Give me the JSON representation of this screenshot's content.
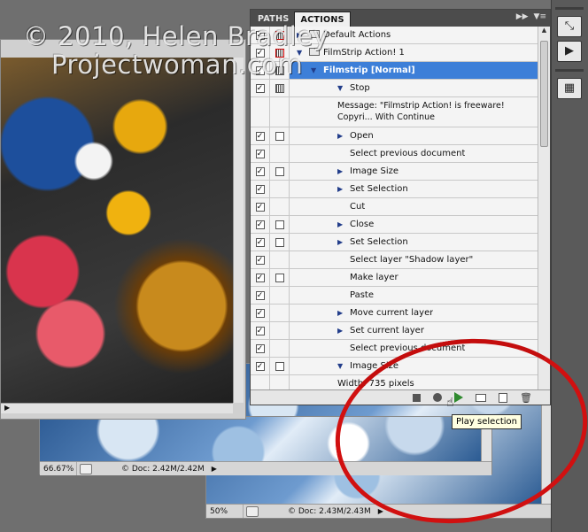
{
  "watermark": {
    "line1": "© 2010, Helen Bradley",
    "line2": "Projectwoman.com"
  },
  "docs": {
    "back": {
      "zoom": "50%",
      "size": "© Doc: 2.43M/2.43M"
    },
    "middle": {
      "zoom": "66.67%",
      "size": "© Doc: 2.42M/2.42M"
    }
  },
  "panel": {
    "tabs": [
      {
        "label": "PATHS",
        "active": false
      },
      {
        "label": "ACTIONS",
        "active": true
      }
    ],
    "menu_icons": [
      "collapse-icon",
      "panel-menu-icon"
    ],
    "rows": [
      {
        "label": "Default Actions",
        "checked": true,
        "dialog": "red",
        "level": 0,
        "expander": "right",
        "folder": true
      },
      {
        "label": "FilmStrip Action! 1",
        "checked": true,
        "dialog": "red",
        "level": 0,
        "expander": "down",
        "folder": true
      },
      {
        "label": "Filmstrip [Normal]",
        "checked": true,
        "dialog": "dotted",
        "level": 1,
        "expander": "down",
        "selected": true
      },
      {
        "label": "Stop",
        "checked": true,
        "dialog": "dotted",
        "level": 2,
        "expander": "down"
      },
      {
        "label": "Message: \"Filmstrip Action! is freeware! Copyri... With Continue",
        "checked": false,
        "dialog": "none",
        "level": 3,
        "expander": "none",
        "tall": true
      },
      {
        "label": "Open",
        "checked": true,
        "dialog": "empty",
        "level": 2,
        "expander": "right"
      },
      {
        "label": "Select previous document",
        "checked": true,
        "dialog": "none",
        "level": 2,
        "expander": "none"
      },
      {
        "label": "Image Size",
        "checked": true,
        "dialog": "empty",
        "level": 2,
        "expander": "right"
      },
      {
        "label": "Set Selection",
        "checked": true,
        "dialog": "none",
        "level": 2,
        "expander": "right"
      },
      {
        "label": "Cut",
        "checked": true,
        "dialog": "none",
        "level": 2,
        "expander": "none"
      },
      {
        "label": "Close",
        "checked": true,
        "dialog": "empty",
        "level": 2,
        "expander": "right"
      },
      {
        "label": "Set Selection",
        "checked": true,
        "dialog": "empty",
        "level": 2,
        "expander": "right"
      },
      {
        "label": "Select layer \"Shadow layer\"",
        "checked": true,
        "dialog": "none",
        "level": 2,
        "expander": "none"
      },
      {
        "label": "Make layer",
        "checked": true,
        "dialog": "empty",
        "level": 2,
        "expander": "none"
      },
      {
        "label": "Paste",
        "checked": true,
        "dialog": "none",
        "level": 2,
        "expander": "none"
      },
      {
        "label": "Move current layer",
        "checked": true,
        "dialog": "none",
        "level": 2,
        "expander": "right"
      },
      {
        "label": "Set current layer",
        "checked": true,
        "dialog": "none",
        "level": 2,
        "expander": "right"
      },
      {
        "label": "Select previous document",
        "checked": true,
        "dialog": "none",
        "level": 2,
        "expander": "none"
      },
      {
        "label": "Image Size",
        "checked": true,
        "dialog": "empty",
        "level": 2,
        "expander": "down"
      },
      {
        "label": "Width: 735 pixels",
        "checked": false,
        "dialog": "none",
        "level": 3,
        "expander": "none"
      }
    ],
    "footer_buttons": [
      "stop-icon",
      "record-icon",
      "play-icon",
      "folder-icon",
      "new-action-icon",
      "trash-icon"
    ]
  },
  "tooltip": "Play selection",
  "toolbar": [
    "arrange-icon",
    "play-icon",
    "grid-icon"
  ],
  "colors": {
    "selection": "#3d7fd8",
    "annotation": "#d11010",
    "tooltip_bg": "#ffffe1"
  }
}
